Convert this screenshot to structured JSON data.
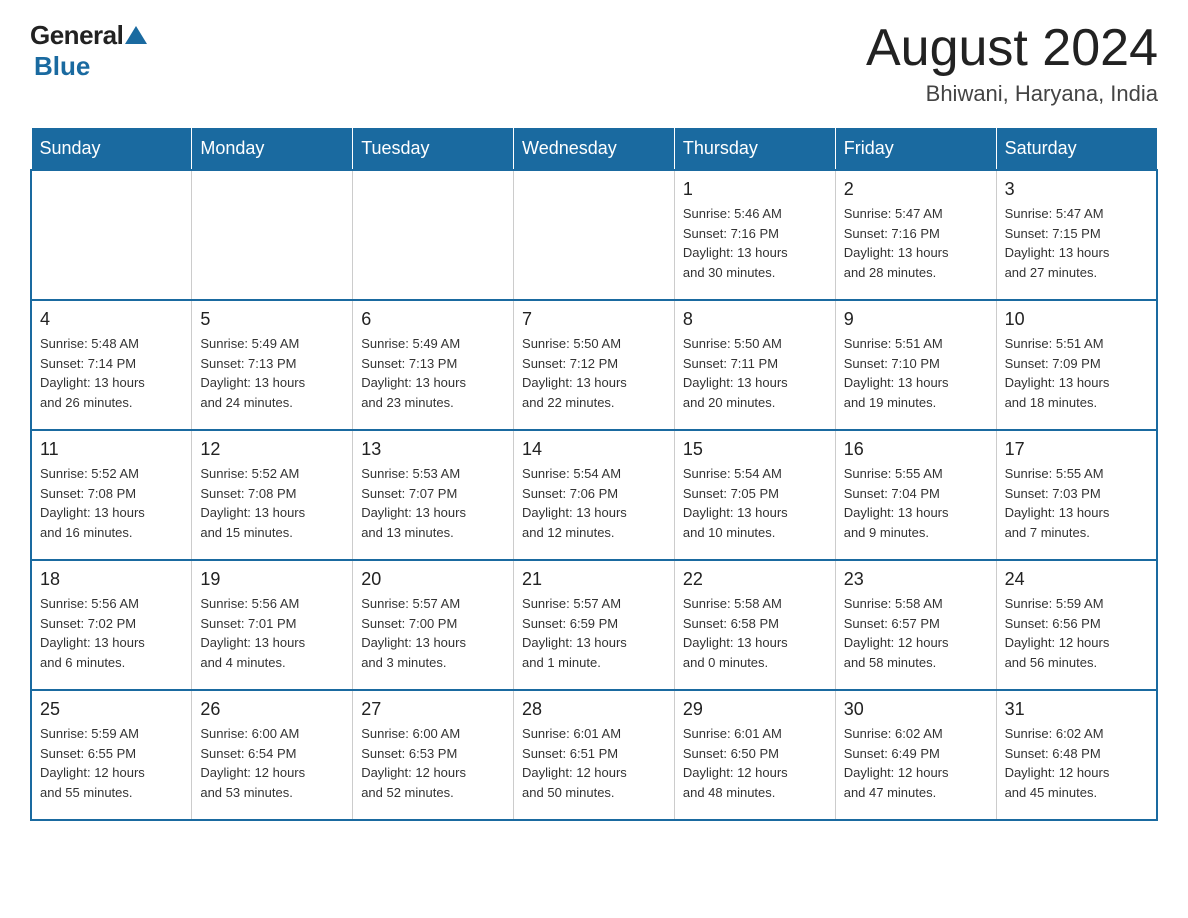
{
  "header": {
    "logo_general": "General",
    "logo_blue": "Blue",
    "month_title": "August 2024",
    "location": "Bhiwani, Haryana, India"
  },
  "weekdays": [
    "Sunday",
    "Monday",
    "Tuesday",
    "Wednesday",
    "Thursday",
    "Friday",
    "Saturday"
  ],
  "weeks": [
    [
      {
        "day": "",
        "info": ""
      },
      {
        "day": "",
        "info": ""
      },
      {
        "day": "",
        "info": ""
      },
      {
        "day": "",
        "info": ""
      },
      {
        "day": "1",
        "info": "Sunrise: 5:46 AM\nSunset: 7:16 PM\nDaylight: 13 hours\nand 30 minutes."
      },
      {
        "day": "2",
        "info": "Sunrise: 5:47 AM\nSunset: 7:16 PM\nDaylight: 13 hours\nand 28 minutes."
      },
      {
        "day": "3",
        "info": "Sunrise: 5:47 AM\nSunset: 7:15 PM\nDaylight: 13 hours\nand 27 minutes."
      }
    ],
    [
      {
        "day": "4",
        "info": "Sunrise: 5:48 AM\nSunset: 7:14 PM\nDaylight: 13 hours\nand 26 minutes."
      },
      {
        "day": "5",
        "info": "Sunrise: 5:49 AM\nSunset: 7:13 PM\nDaylight: 13 hours\nand 24 minutes."
      },
      {
        "day": "6",
        "info": "Sunrise: 5:49 AM\nSunset: 7:13 PM\nDaylight: 13 hours\nand 23 minutes."
      },
      {
        "day": "7",
        "info": "Sunrise: 5:50 AM\nSunset: 7:12 PM\nDaylight: 13 hours\nand 22 minutes."
      },
      {
        "day": "8",
        "info": "Sunrise: 5:50 AM\nSunset: 7:11 PM\nDaylight: 13 hours\nand 20 minutes."
      },
      {
        "day": "9",
        "info": "Sunrise: 5:51 AM\nSunset: 7:10 PM\nDaylight: 13 hours\nand 19 minutes."
      },
      {
        "day": "10",
        "info": "Sunrise: 5:51 AM\nSunset: 7:09 PM\nDaylight: 13 hours\nand 18 minutes."
      }
    ],
    [
      {
        "day": "11",
        "info": "Sunrise: 5:52 AM\nSunset: 7:08 PM\nDaylight: 13 hours\nand 16 minutes."
      },
      {
        "day": "12",
        "info": "Sunrise: 5:52 AM\nSunset: 7:08 PM\nDaylight: 13 hours\nand 15 minutes."
      },
      {
        "day": "13",
        "info": "Sunrise: 5:53 AM\nSunset: 7:07 PM\nDaylight: 13 hours\nand 13 minutes."
      },
      {
        "day": "14",
        "info": "Sunrise: 5:54 AM\nSunset: 7:06 PM\nDaylight: 13 hours\nand 12 minutes."
      },
      {
        "day": "15",
        "info": "Sunrise: 5:54 AM\nSunset: 7:05 PM\nDaylight: 13 hours\nand 10 minutes."
      },
      {
        "day": "16",
        "info": "Sunrise: 5:55 AM\nSunset: 7:04 PM\nDaylight: 13 hours\nand 9 minutes."
      },
      {
        "day": "17",
        "info": "Sunrise: 5:55 AM\nSunset: 7:03 PM\nDaylight: 13 hours\nand 7 minutes."
      }
    ],
    [
      {
        "day": "18",
        "info": "Sunrise: 5:56 AM\nSunset: 7:02 PM\nDaylight: 13 hours\nand 6 minutes."
      },
      {
        "day": "19",
        "info": "Sunrise: 5:56 AM\nSunset: 7:01 PM\nDaylight: 13 hours\nand 4 minutes."
      },
      {
        "day": "20",
        "info": "Sunrise: 5:57 AM\nSunset: 7:00 PM\nDaylight: 13 hours\nand 3 minutes."
      },
      {
        "day": "21",
        "info": "Sunrise: 5:57 AM\nSunset: 6:59 PM\nDaylight: 13 hours\nand 1 minute."
      },
      {
        "day": "22",
        "info": "Sunrise: 5:58 AM\nSunset: 6:58 PM\nDaylight: 13 hours\nand 0 minutes."
      },
      {
        "day": "23",
        "info": "Sunrise: 5:58 AM\nSunset: 6:57 PM\nDaylight: 12 hours\nand 58 minutes."
      },
      {
        "day": "24",
        "info": "Sunrise: 5:59 AM\nSunset: 6:56 PM\nDaylight: 12 hours\nand 56 minutes."
      }
    ],
    [
      {
        "day": "25",
        "info": "Sunrise: 5:59 AM\nSunset: 6:55 PM\nDaylight: 12 hours\nand 55 minutes."
      },
      {
        "day": "26",
        "info": "Sunrise: 6:00 AM\nSunset: 6:54 PM\nDaylight: 12 hours\nand 53 minutes."
      },
      {
        "day": "27",
        "info": "Sunrise: 6:00 AM\nSunset: 6:53 PM\nDaylight: 12 hours\nand 52 minutes."
      },
      {
        "day": "28",
        "info": "Sunrise: 6:01 AM\nSunset: 6:51 PM\nDaylight: 12 hours\nand 50 minutes."
      },
      {
        "day": "29",
        "info": "Sunrise: 6:01 AM\nSunset: 6:50 PM\nDaylight: 12 hours\nand 48 minutes."
      },
      {
        "day": "30",
        "info": "Sunrise: 6:02 AM\nSunset: 6:49 PM\nDaylight: 12 hours\nand 47 minutes."
      },
      {
        "day": "31",
        "info": "Sunrise: 6:02 AM\nSunset: 6:48 PM\nDaylight: 12 hours\nand 45 minutes."
      }
    ]
  ]
}
